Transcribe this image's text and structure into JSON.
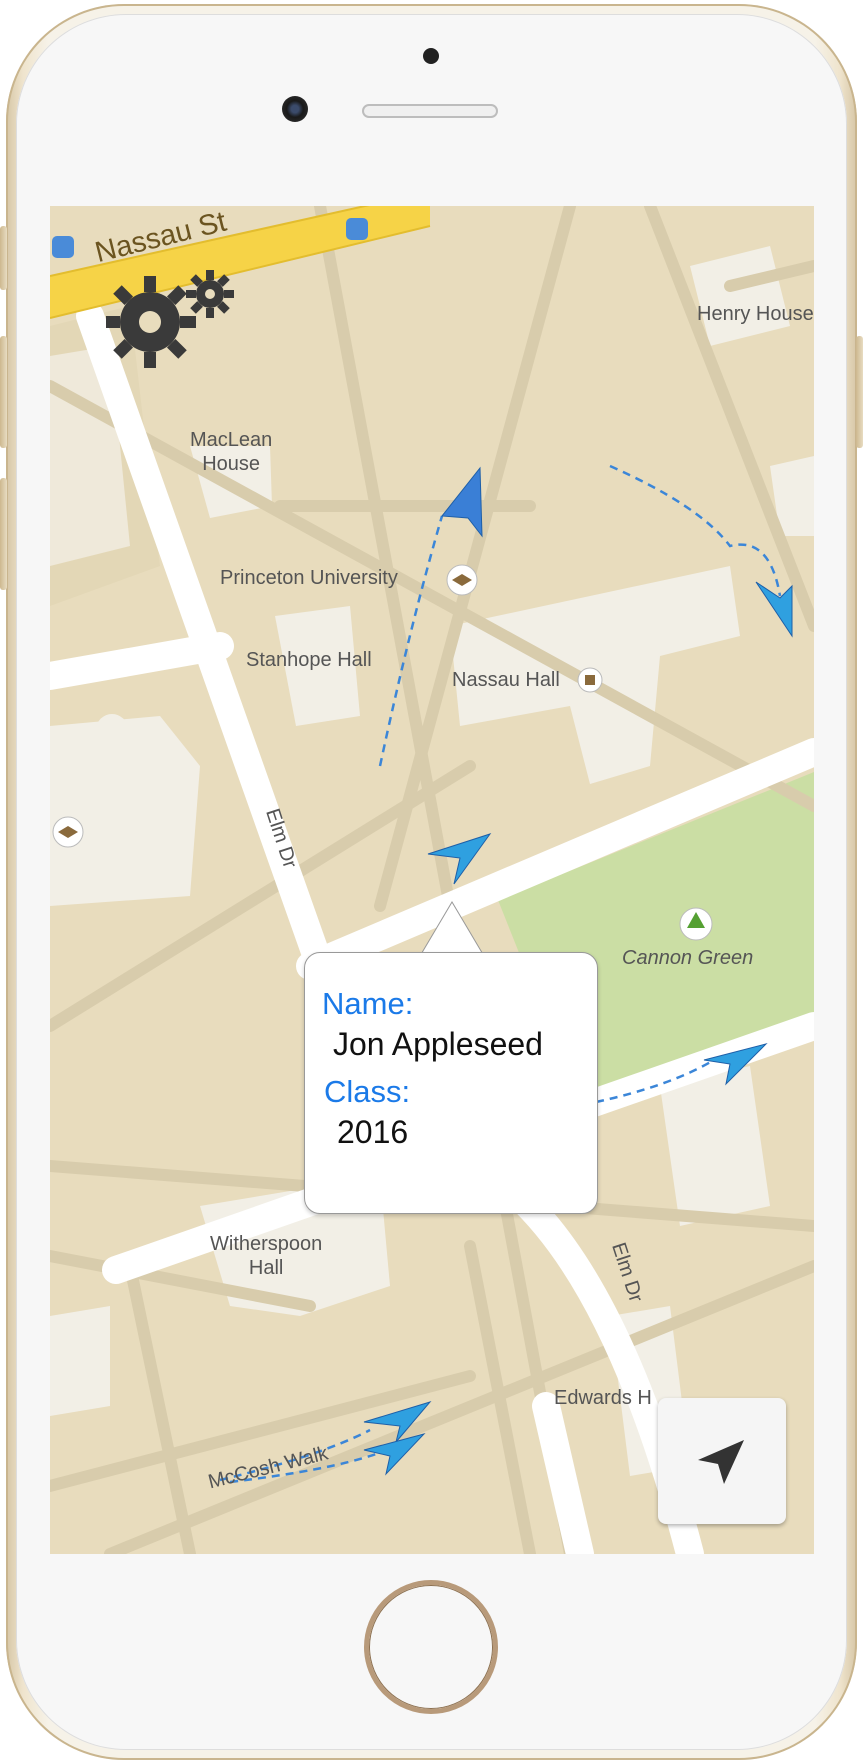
{
  "map": {
    "labels": {
      "nassau_st": "Nassau St",
      "maclean_house": "MacLean\nHouse",
      "princeton_university": "Princeton University",
      "stanhope_hall": "Stanhope Hall",
      "nassau_hall": "Nassau Hall",
      "henry_house": "Henry House",
      "elm_dr_1": "Elm Dr",
      "elm_dr_2": "Elm Dr",
      "cannon_green": "Cannon Green",
      "witherspoon_hall": "Witherspoon\nHall",
      "mccosh_walk": "McCosh Walk",
      "edwards_hall": "Edwards H"
    },
    "colors": {
      "land": "#e8dcbd",
      "building": "#f2efe6",
      "road": "#ffffff",
      "highway": "#f6d347",
      "park": "#cbdea4",
      "path": "#d8ccac",
      "arrow": "#2a8fe0",
      "trail": "#3b86d8"
    }
  },
  "settings": {
    "icon": "gear-icon"
  },
  "callout": {
    "name_label": "Name:",
    "name_value": "Jon Appleseed",
    "class_label": "Class:",
    "class_value": "2016"
  },
  "locate_button": {
    "icon": "navigation-arrow-icon"
  }
}
